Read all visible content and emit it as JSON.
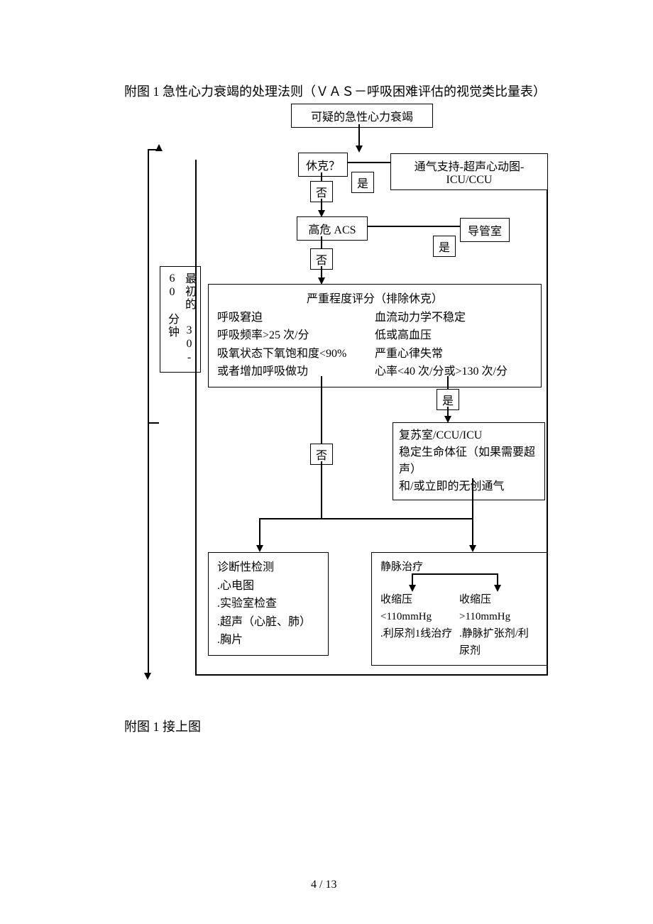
{
  "title": "附图 1 急性心力衰竭的处理法则（ＶＡＳ－呼吸困难评估的视觉类比量表）",
  "sidebar_label": "最初的 30-60 分钟",
  "box_suspect": "可疑的急性心力衰竭",
  "box_shock": "休克？",
  "label_yes1": "是",
  "label_no1": "否",
  "box_vent_support": "通气支持-超声心动图-ICU/CCU",
  "box_acs": "高危 ACS",
  "label_yes2": "是",
  "label_no2": "否",
  "box_cath": "导管室",
  "severity": {
    "title": "严重程度评分（排除休克）",
    "left": [
      "呼吸窘迫",
      "呼吸频率>25 次/分",
      "吸氧状态下氧饱和度<90%",
      "或者增加呼吸做功"
    ],
    "right": [
      "血流动力学不稳定",
      "低或高血压",
      "严重心律失常",
      "心率<40 次/分或>130 次/分"
    ]
  },
  "label_yes3": "是",
  "label_no3": "否",
  "box_resus": [
    "复苏室/CCU/ICU",
    "稳定生命体征（如果需要超声）",
    "和/或立即的无创通气"
  ],
  "box_diag": {
    "title": "诊断性检测",
    "items": [
      ".心电图",
      ".实验室检查",
      ".超声（心脏、肺）",
      ".胸片"
    ]
  },
  "box_iv": {
    "title": "静脉治疗",
    "left": [
      "收缩压<110mmHg",
      ".利尿剂1线治疗"
    ],
    "right": [
      "收缩压>110mmHg",
      ".静脉扩张剂/利尿剂"
    ]
  },
  "footer": "附图 1 接上图",
  "page": "4 / 13"
}
